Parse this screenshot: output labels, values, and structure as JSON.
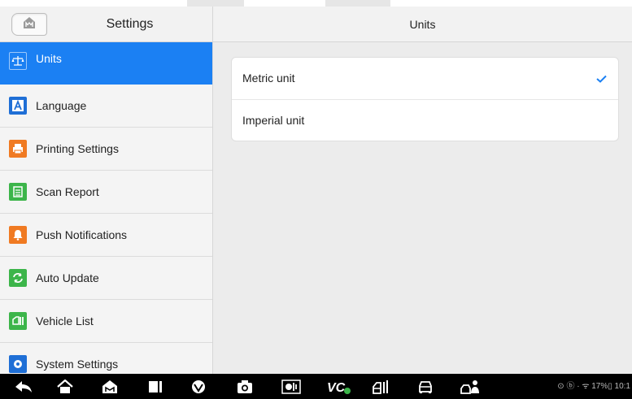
{
  "header": {
    "sidebar_title": "Settings",
    "page_title": "Units"
  },
  "sidebar": {
    "items": [
      {
        "label": "Units",
        "icon": "scale-icon",
        "active": true,
        "color": "#1b80f3"
      },
      {
        "label": "Language",
        "icon": "language-icon",
        "color": "#1f6fd6"
      },
      {
        "label": "Printing Settings",
        "icon": "printer-icon",
        "color": "#f07a22"
      },
      {
        "label": "Scan Report",
        "icon": "report-icon",
        "color": "#3cb54a"
      },
      {
        "label": "Push Notifications",
        "icon": "notification-icon",
        "color": "#f07a22"
      },
      {
        "label": "Auto Update",
        "icon": "update-icon",
        "color": "#3cb54a"
      },
      {
        "label": "Vehicle List",
        "icon": "vehicle-list-icon",
        "color": "#3cb54a"
      },
      {
        "label": "System Settings",
        "icon": "gear-icon",
        "color": "#1f6fd6"
      }
    ]
  },
  "units": {
    "options": [
      {
        "label": "Metric unit",
        "selected": true
      },
      {
        "label": "Imperial unit",
        "selected": false
      }
    ]
  },
  "status_bar": {
    "text": "⊙ ⓑ · ᯤ 17%▯ 10:1"
  },
  "colors": {
    "accent": "#1b80f3",
    "check": "#1b80f3",
    "navbar": "#000000"
  }
}
